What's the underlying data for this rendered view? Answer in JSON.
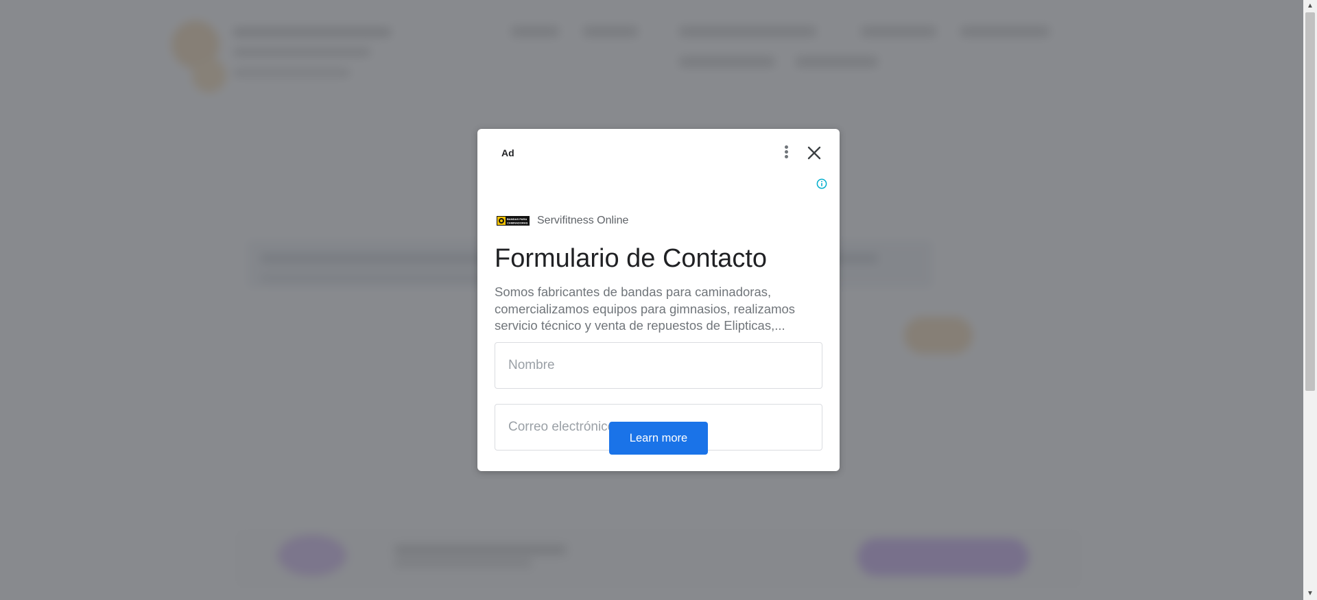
{
  "ad": {
    "label": "Ad",
    "advertiser": "Servifitness Online",
    "logo_text_line1": "BANDAS PARA",
    "logo_text_line2": "CAMINADORAS",
    "headline": "Formulario de Contacto",
    "description": "Somos fabricantes de bandas para caminadoras, comercializamos equipos para gimnasios, realizamos servicio técnico y venta de repuestos de Elipticas,...",
    "name_placeholder": "Nombre",
    "email_placeholder": "Correo electrónico",
    "cta_label": "Learn more",
    "accent_color": "#1a73e8"
  },
  "icons": {
    "more": "more-vert-icon",
    "close": "close-icon",
    "info": "info-icon",
    "scroll_up": "chevron-up-icon",
    "scroll_down": "chevron-down-icon"
  },
  "scroll": {
    "up_glyph": "▲",
    "down_glyph": "▼"
  }
}
